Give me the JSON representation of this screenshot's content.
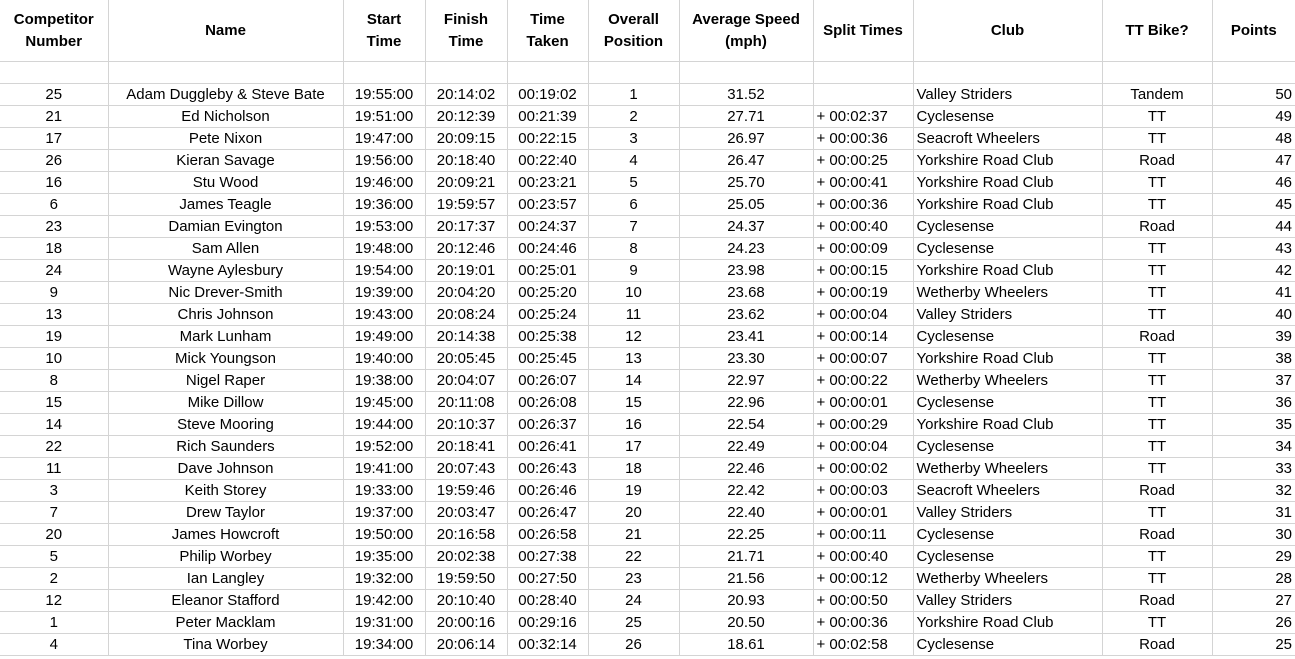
{
  "headers": [
    {
      "key": "competitor_number",
      "label": "Competitor\nNumber"
    },
    {
      "key": "name",
      "label": "Name"
    },
    {
      "key": "start_time",
      "label": "Start\nTime"
    },
    {
      "key": "finish_time",
      "label": "Finish\nTime"
    },
    {
      "key": "time_taken",
      "label": "Time\nTaken"
    },
    {
      "key": "overall_position",
      "label": "Overall\nPosition"
    },
    {
      "key": "average_speed",
      "label": "Average Speed\n(mph)"
    },
    {
      "key": "split_times",
      "label": "Split Times"
    },
    {
      "key": "club",
      "label": "Club"
    },
    {
      "key": "tt_bike",
      "label": "TT Bike?"
    },
    {
      "key": "points",
      "label": "Points"
    }
  ],
  "rows": [
    {
      "number": "25",
      "name": "Adam Duggleby & Steve Bate",
      "start": "19:55:00",
      "finish": "20:14:02",
      "taken": "00:19:02",
      "position": "1",
      "speed": "31.52",
      "split": "",
      "club": "Valley Striders",
      "bike": "Tandem",
      "points": "50"
    },
    {
      "number": "21",
      "name": "Ed Nicholson",
      "start": "19:51:00",
      "finish": "20:12:39",
      "taken": "00:21:39",
      "position": "2",
      "speed": "27.71",
      "split": "+ 00:02:37",
      "club": "Cyclesense",
      "bike": "TT",
      "points": "49"
    },
    {
      "number": "17",
      "name": "Pete Nixon",
      "start": "19:47:00",
      "finish": "20:09:15",
      "taken": "00:22:15",
      "position": "3",
      "speed": "26.97",
      "split": "+ 00:00:36",
      "club": "Seacroft Wheelers",
      "bike": "TT",
      "points": "48"
    },
    {
      "number": "26",
      "name": "Kieran Savage",
      "start": "19:56:00",
      "finish": "20:18:40",
      "taken": "00:22:40",
      "position": "4",
      "speed": "26.47",
      "split": "+ 00:00:25",
      "club": "Yorkshire Road Club",
      "bike": "Road",
      "points": "47"
    },
    {
      "number": "16",
      "name": "Stu Wood",
      "start": "19:46:00",
      "finish": "20:09:21",
      "taken": "00:23:21",
      "position": "5",
      "speed": "25.70",
      "split": "+ 00:00:41",
      "club": "Yorkshire Road Club",
      "bike": "TT",
      "points": "46"
    },
    {
      "number": "6",
      "name": "James Teagle",
      "start": "19:36:00",
      "finish": "19:59:57",
      "taken": "00:23:57",
      "position": "6",
      "speed": "25.05",
      "split": "+ 00:00:36",
      "club": "Yorkshire Road Club",
      "bike": "TT",
      "points": "45"
    },
    {
      "number": "23",
      "name": "Damian Evington",
      "start": "19:53:00",
      "finish": "20:17:37",
      "taken": "00:24:37",
      "position": "7",
      "speed": "24.37",
      "split": "+ 00:00:40",
      "club": "Cyclesense",
      "bike": "Road",
      "points": "44"
    },
    {
      "number": "18",
      "name": "Sam Allen",
      "start": "19:48:00",
      "finish": "20:12:46",
      "taken": "00:24:46",
      "position": "8",
      "speed": "24.23",
      "split": "+ 00:00:09",
      "club": "Cyclesense",
      "bike": "TT",
      "points": "43"
    },
    {
      "number": "24",
      "name": "Wayne Aylesbury",
      "start": "19:54:00",
      "finish": "20:19:01",
      "taken": "00:25:01",
      "position": "9",
      "speed": "23.98",
      "split": "+ 00:00:15",
      "club": "Yorkshire Road Club",
      "bike": "TT",
      "points": "42"
    },
    {
      "number": "9",
      "name": "Nic Drever-Smith",
      "start": "19:39:00",
      "finish": "20:04:20",
      "taken": "00:25:20",
      "position": "10",
      "speed": "23.68",
      "split": "+ 00:00:19",
      "club": "Wetherby Wheelers",
      "bike": "TT",
      "points": "41"
    },
    {
      "number": "13",
      "name": "Chris Johnson",
      "start": "19:43:00",
      "finish": "20:08:24",
      "taken": "00:25:24",
      "position": "11",
      "speed": "23.62",
      "split": "+ 00:00:04",
      "club": "Valley Striders",
      "bike": "TT",
      "points": "40"
    },
    {
      "number": "19",
      "name": "Mark Lunham",
      "start": "19:49:00",
      "finish": "20:14:38",
      "taken": "00:25:38",
      "position": "12",
      "speed": "23.41",
      "split": "+ 00:00:14",
      "club": "Cyclesense",
      "bike": "Road",
      "points": "39"
    },
    {
      "number": "10",
      "name": "Mick Youngson",
      "start": "19:40:00",
      "finish": "20:05:45",
      "taken": "00:25:45",
      "position": "13",
      "speed": "23.30",
      "split": "+ 00:00:07",
      "club": "Yorkshire Road Club",
      "bike": "TT",
      "points": "38"
    },
    {
      "number": "8",
      "name": "Nigel Raper",
      "start": "19:38:00",
      "finish": "20:04:07",
      "taken": "00:26:07",
      "position": "14",
      "speed": "22.97",
      "split": "+ 00:00:22",
      "club": "Wetherby Wheelers",
      "bike": "TT",
      "points": "37"
    },
    {
      "number": "15",
      "name": "Mike Dillow",
      "start": "19:45:00",
      "finish": "20:11:08",
      "taken": "00:26:08",
      "position": "15",
      "speed": "22.96",
      "split": "+ 00:00:01",
      "club": "Cyclesense",
      "bike": "TT",
      "points": "36"
    },
    {
      "number": "14",
      "name": "Steve Mooring",
      "start": "19:44:00",
      "finish": "20:10:37",
      "taken": "00:26:37",
      "position": "16",
      "speed": "22.54",
      "split": "+ 00:00:29",
      "club": "Yorkshire Road Club",
      "bike": "TT",
      "points": "35"
    },
    {
      "number": "22",
      "name": "Rich Saunders",
      "start": "19:52:00",
      "finish": "20:18:41",
      "taken": "00:26:41",
      "position": "17",
      "speed": "22.49",
      "split": "+ 00:00:04",
      "club": "Cyclesense",
      "bike": "TT",
      "points": "34"
    },
    {
      "number": "11",
      "name": "Dave Johnson",
      "start": "19:41:00",
      "finish": "20:07:43",
      "taken": "00:26:43",
      "position": "18",
      "speed": "22.46",
      "split": "+ 00:00:02",
      "club": "Wetherby Wheelers",
      "bike": "TT",
      "points": "33"
    },
    {
      "number": "3",
      "name": "Keith Storey",
      "start": "19:33:00",
      "finish": "19:59:46",
      "taken": "00:26:46",
      "position": "19",
      "speed": "22.42",
      "split": "+ 00:00:03",
      "club": "Seacroft Wheelers",
      "bike": "Road",
      "points": "32"
    },
    {
      "number": "7",
      "name": "Drew Taylor",
      "start": "19:37:00",
      "finish": "20:03:47",
      "taken": "00:26:47",
      "position": "20",
      "speed": "22.40",
      "split": "+ 00:00:01",
      "club": "Valley Striders",
      "bike": "TT",
      "points": "31"
    },
    {
      "number": "20",
      "name": "James Howcroft",
      "start": "19:50:00",
      "finish": "20:16:58",
      "taken": "00:26:58",
      "position": "21",
      "speed": "22.25",
      "split": "+ 00:00:11",
      "club": "Cyclesense",
      "bike": "Road",
      "points": "30"
    },
    {
      "number": "5",
      "name": "Philip Worbey",
      "start": "19:35:00",
      "finish": "20:02:38",
      "taken": "00:27:38",
      "position": "22",
      "speed": "21.71",
      "split": "+ 00:00:40",
      "club": "Cyclesense",
      "bike": "TT",
      "points": "29"
    },
    {
      "number": "2",
      "name": "Ian Langley",
      "start": "19:32:00",
      "finish": "19:59:50",
      "taken": "00:27:50",
      "position": "23",
      "speed": "21.56",
      "split": "+ 00:00:12",
      "club": "Wetherby Wheelers",
      "bike": "TT",
      "points": "28"
    },
    {
      "number": "12",
      "name": "Eleanor Stafford",
      "start": "19:42:00",
      "finish": "20:10:40",
      "taken": "00:28:40",
      "position": "24",
      "speed": "20.93",
      "split": "+ 00:00:50",
      "club": "Valley Striders",
      "bike": "Road",
      "points": "27"
    },
    {
      "number": "1",
      "name": "Peter Macklam",
      "start": "19:31:00",
      "finish": "20:00:16",
      "taken": "00:29:16",
      "position": "25",
      "speed": "20.50",
      "split": "+ 00:00:36",
      "club": "Yorkshire Road Club",
      "bike": "TT",
      "points": "26"
    },
    {
      "number": "4",
      "name": "Tina Worbey",
      "start": "19:34:00",
      "finish": "20:06:14",
      "taken": "00:32:14",
      "position": "26",
      "speed": "18.61",
      "split": "+ 00:02:58",
      "club": "Cyclesense",
      "bike": "Road",
      "points": "25"
    }
  ]
}
